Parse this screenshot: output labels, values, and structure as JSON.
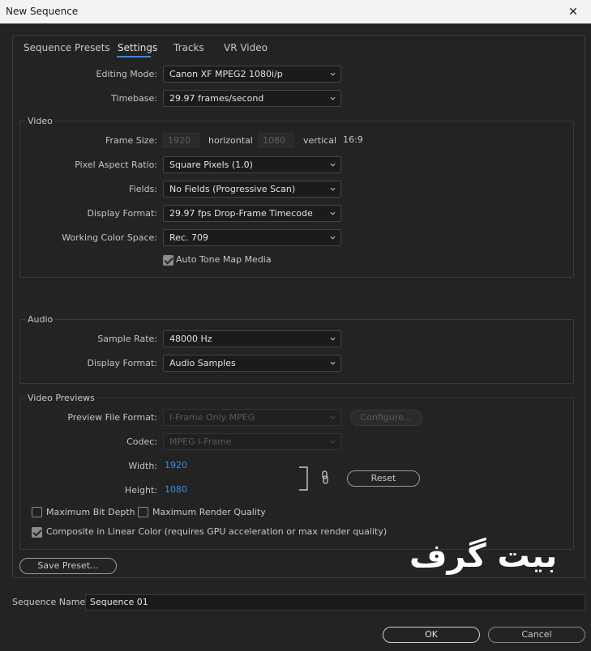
{
  "window": {
    "title": "New Sequence",
    "close_glyph": "✕"
  },
  "tabs": [
    {
      "label": "Sequence Presets",
      "active": false
    },
    {
      "label": "Settings",
      "active": true
    },
    {
      "label": "Tracks",
      "active": false
    },
    {
      "label": "VR Video",
      "active": false
    }
  ],
  "settings": {
    "editing_mode": {
      "label": "Editing Mode:",
      "value": "Canon XF MPEG2 1080i/p"
    },
    "timebase": {
      "label": "Timebase:",
      "value": "29.97  frames/second"
    }
  },
  "video": {
    "title": "Video",
    "frame_size": {
      "label": "Frame Size:",
      "width": "1920",
      "horizontal_label": "horizontal",
      "height": "1080",
      "vertical_label": "vertical",
      "aspect": "16:9"
    },
    "pixel_aspect": {
      "label": "Pixel Aspect Ratio:",
      "value": "Square Pixels (1.0)"
    },
    "fields": {
      "label": "Fields:",
      "value": "No Fields (Progressive Scan)"
    },
    "display_format": {
      "label": "Display Format:",
      "value": "29.97 fps Drop-Frame Timecode"
    },
    "working_color_space": {
      "label": "Working Color Space:",
      "value": "Rec. 709"
    },
    "auto_tone_map": {
      "label": "Auto Tone Map Media",
      "checked": true
    }
  },
  "audio": {
    "title": "Audio",
    "sample_rate": {
      "label": "Sample Rate:",
      "value": "48000 Hz"
    },
    "display_format": {
      "label": "Display Format:",
      "value": "Audio Samples"
    }
  },
  "previews": {
    "title": "Video Previews",
    "file_format": {
      "label": "Preview File Format:",
      "value": "I-Frame Only MPEG"
    },
    "configure_label": "Configure...",
    "codec": {
      "label": "Codec:",
      "value": "MPEG I-Frame"
    },
    "width": {
      "label": "Width:",
      "value": "1920"
    },
    "height": {
      "label": "Height:",
      "value": "1080"
    },
    "reset_label": "Reset",
    "max_bit_depth": {
      "label": "Maximum Bit Depth",
      "checked": false
    },
    "max_render_quality": {
      "label": "Maximum Render Quality",
      "checked": false
    },
    "composite_linear": {
      "label": "Composite in Linear Color (requires GPU acceleration or max render quality)",
      "checked": true
    }
  },
  "save_preset_label": "Save Preset...",
  "sequence_name": {
    "label": "Sequence Name:",
    "value": "Sequence 01"
  },
  "ok_label": "OK",
  "cancel_label": "Cancel",
  "watermark": "بیت گرف"
}
